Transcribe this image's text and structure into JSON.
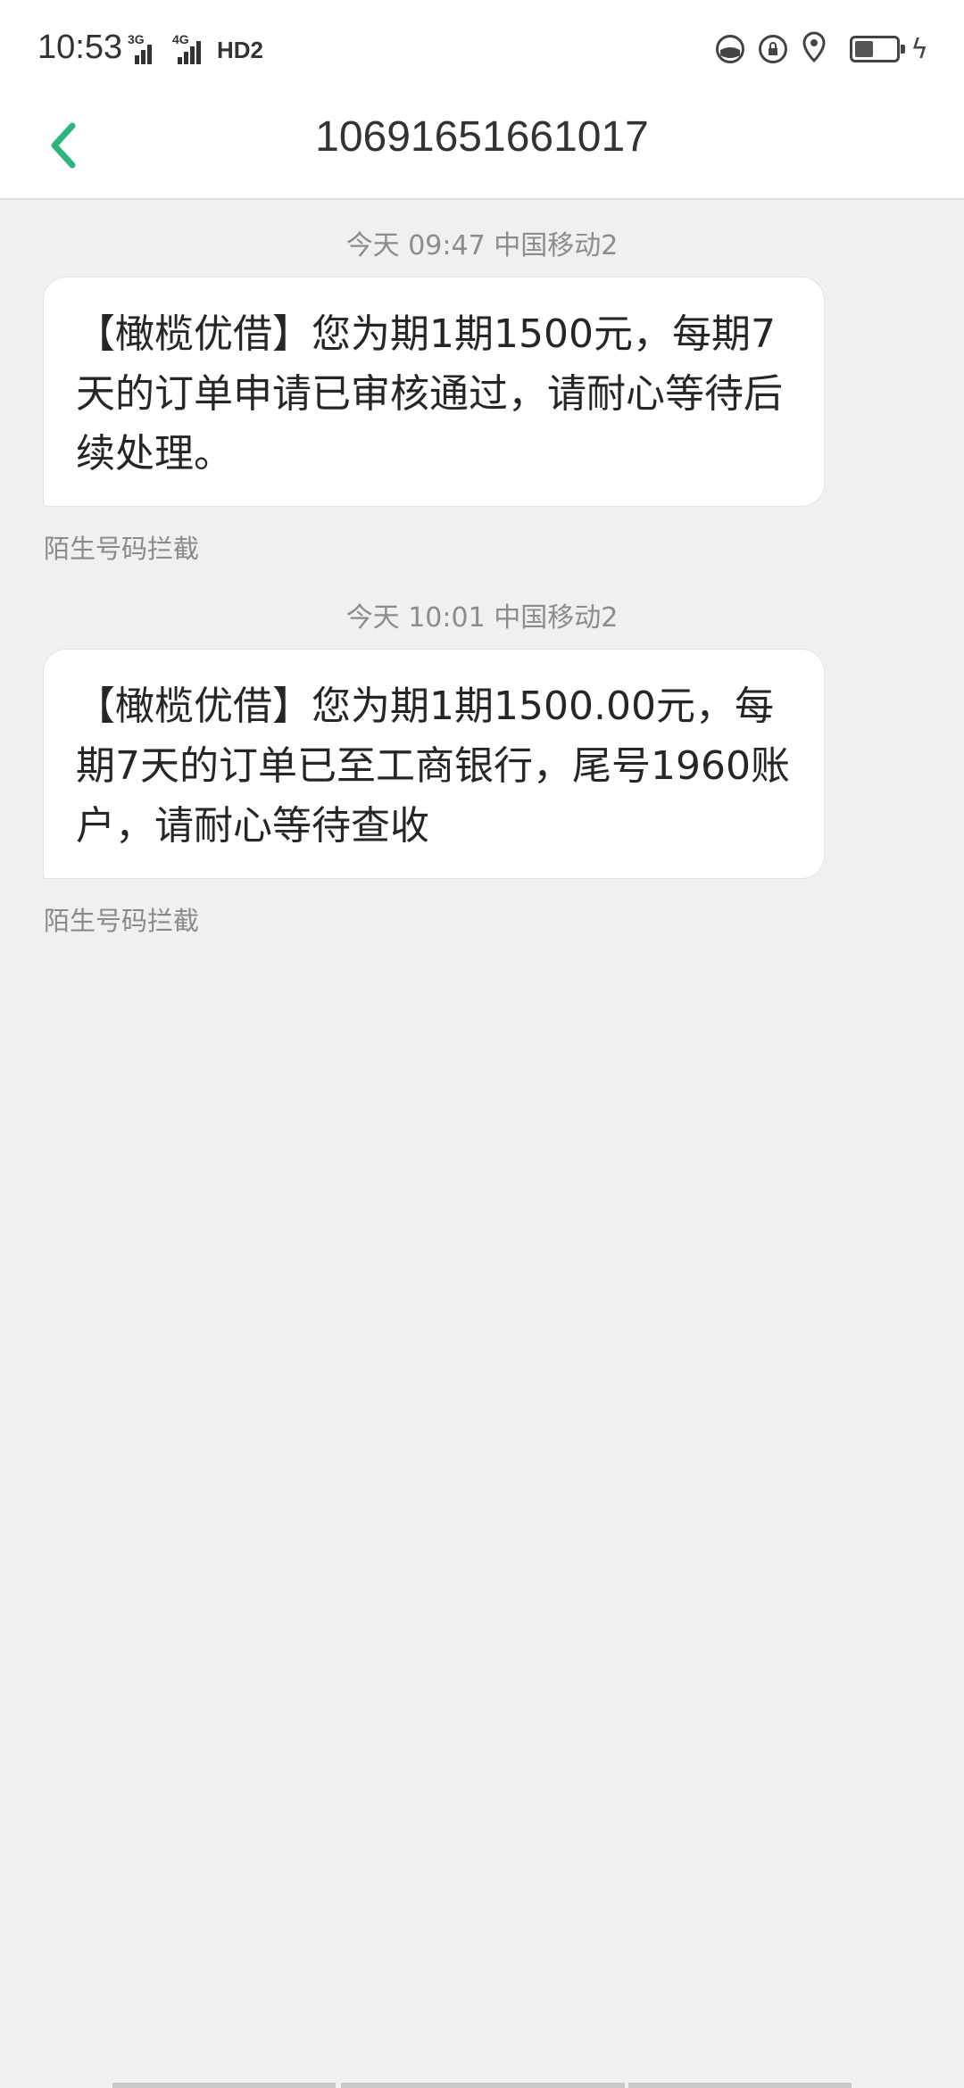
{
  "status": {
    "time": "10:53",
    "signal1_label": "3G",
    "signal2_label": "4G",
    "hd_label": "HD2",
    "battery_level": 0.4
  },
  "header": {
    "title": "10691651661017"
  },
  "messages": [
    {
      "meta": "今天 09:47  中国移动2",
      "body": "【橄榄优借】您为期1期1500元，每期7天的订单申请已审核通过，请耐心等待后续处理。",
      "note": "陌生号码拦截"
    },
    {
      "meta": "今天 10:01  中国移动2",
      "body": "【橄榄优借】您为期1期1500.00元，每期7天的订单已至工商银行，尾号1960账户，请耐心等待查收",
      "note": "陌生号码拦截"
    }
  ],
  "colors": {
    "accent": "#2cb67d",
    "background": "#f0f0f0"
  }
}
